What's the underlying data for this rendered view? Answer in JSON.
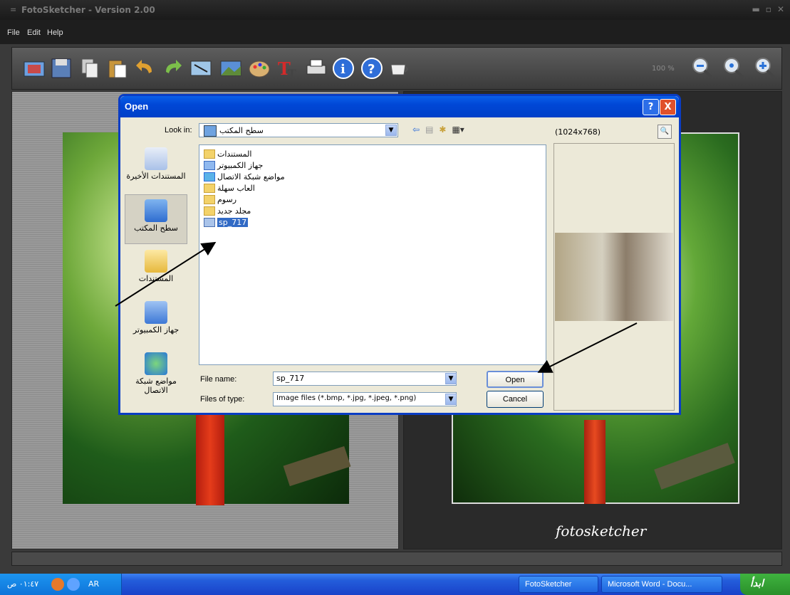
{
  "app": {
    "title": "FotoSketcher - Version 2.00",
    "menu": [
      "File",
      "Edit",
      "Help"
    ],
    "zoom": "100 %",
    "signature": "fotosketcher"
  },
  "dialog": {
    "title": "Open",
    "help_btn": "?",
    "close_btn": "X",
    "look_in_label": "Look in:",
    "look_in_value": "سطح المكتب",
    "preview_dims": "(1024x768)",
    "places": [
      {
        "label": "المستندات الأخيرة"
      },
      {
        "label": "سطح المكتب"
      },
      {
        "label": "المستندات"
      },
      {
        "label": "جهاز الكمبيوتر"
      },
      {
        "label": "مواضع شبكة الاتصال"
      }
    ],
    "files": [
      {
        "name": "المستندات"
      },
      {
        "name": "جهاز الكمبيوتر"
      },
      {
        "name": "مواضع شبكة الاتصال"
      },
      {
        "name": "العاب سهلة"
      },
      {
        "name": "رسوم"
      },
      {
        "name": "مجلد جديد"
      },
      {
        "name": "sp_717"
      }
    ],
    "file_name_label": "File name:",
    "file_name_value": "sp_717",
    "file_type_label": "Files of type:",
    "file_type_value": "Image files (*.bmp, *.jpg, *.jpeg, *.png)",
    "open_button": "Open",
    "cancel_button": "Cancel"
  },
  "taskbar": {
    "clock": "٠١:٤٧ ص",
    "lang": "AR",
    "tasks": [
      "FotoSketcher",
      "Microsoft Word - Docu..."
    ],
    "start": "ابدأ"
  }
}
